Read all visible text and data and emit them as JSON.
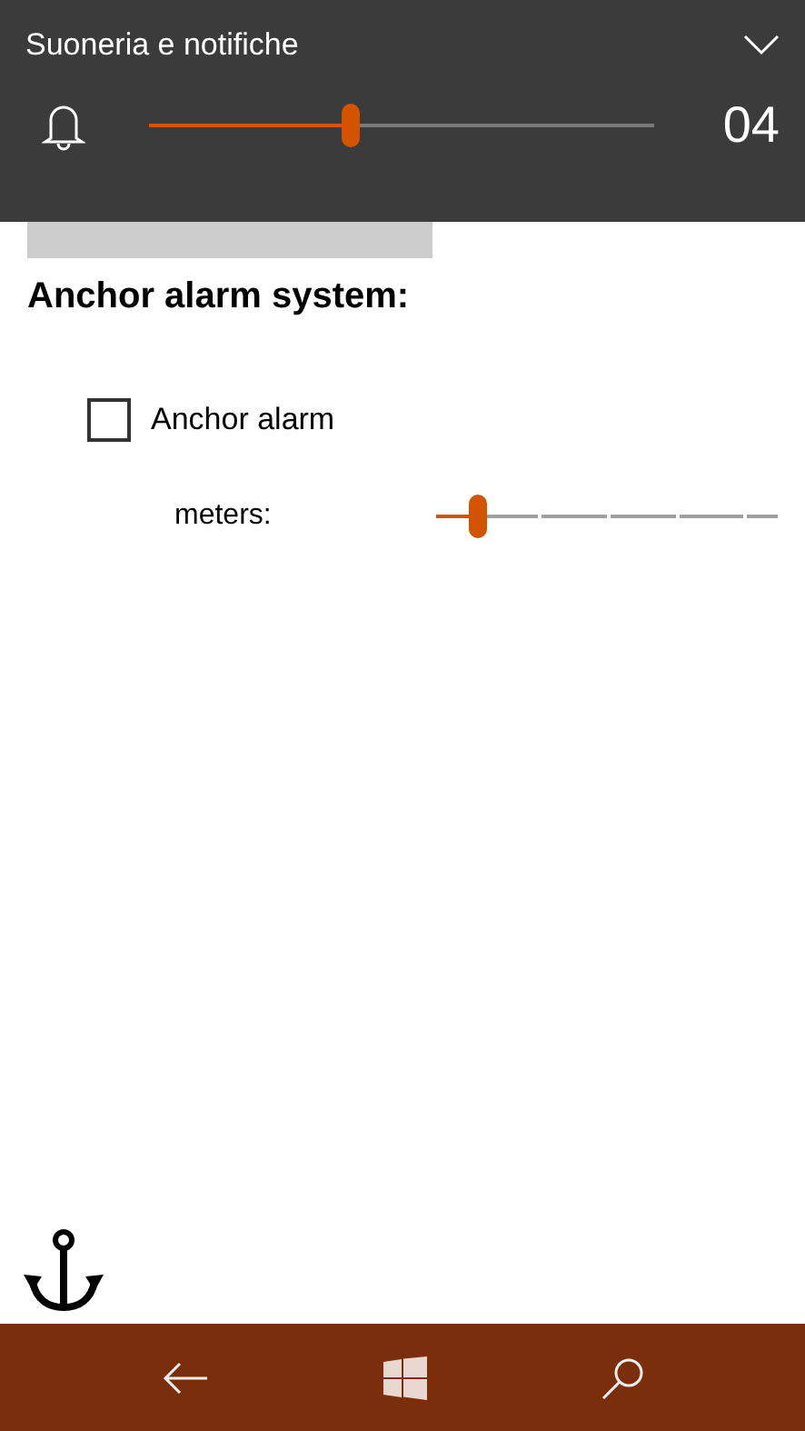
{
  "volume_overlay": {
    "title": "Suoneria e notifiche",
    "level": 0.4,
    "reading": "04"
  },
  "heading": "Anchor alarm system:",
  "anchor_alarm": {
    "label": "Anchor alarm",
    "checked": false
  },
  "meters": {
    "label": "meters:",
    "level": 0.12
  }
}
